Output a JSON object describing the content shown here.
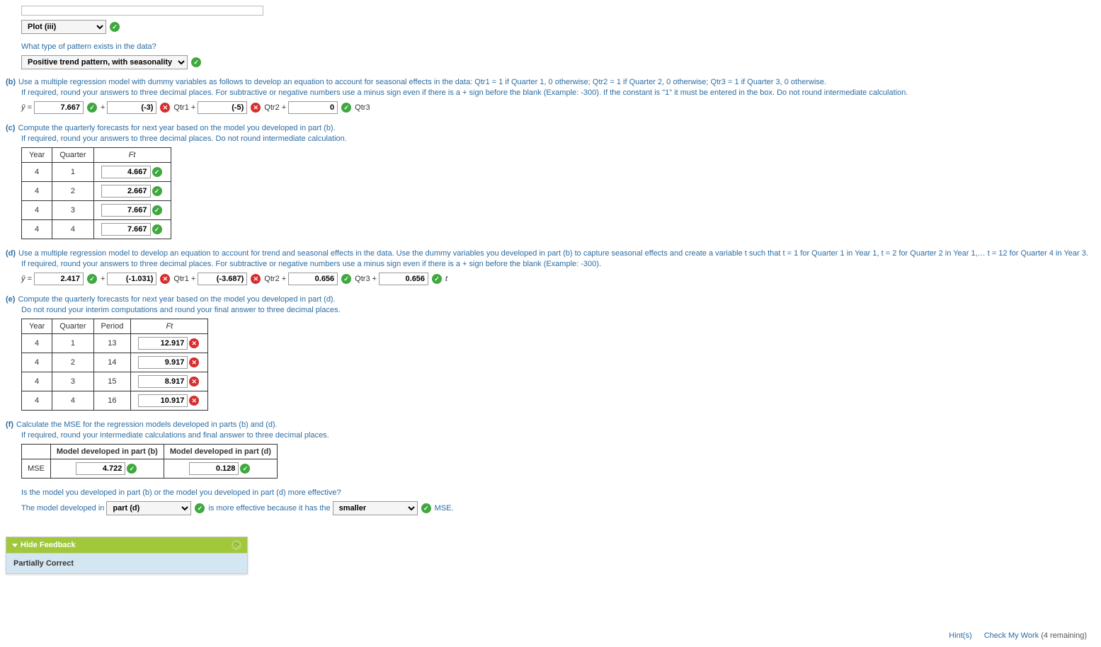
{
  "partA": {
    "plotPlaceholder": "",
    "plotSelection": "Plot (iii)",
    "question": "What type of pattern exists in the data?",
    "patternSelection": "Positive trend pattern, with seasonality"
  },
  "partB": {
    "label": "(b)",
    "prompt": "Use a multiple regression model with dummy variables as follows to develop an equation to account for seasonal effects in the data: Qtr1 = 1 if Quarter 1, 0 otherwise; Qtr2 = 1 if Quarter 2, 0 otherwise; Qtr3 = 1 if Quarter 3, 0 otherwise.",
    "note": "If required, round your answers to three decimal places. For subtractive or negative numbers use a minus sign even if there is a + sign before the blank (Example: -300). If the constant is \"1\" it must be entered in the box. Do not round intermediate calculation.",
    "yhat": "ŷ =",
    "intercept": "7.667",
    "b1": "(-3)",
    "b2": "(-5)",
    "b3": "0",
    "q1": "Qtr1 +",
    "q2": "Qtr2 +",
    "q3": "Qtr3",
    "plus": "+"
  },
  "partC": {
    "label": "(c)",
    "prompt": "Compute the quarterly forecasts for next year based on the model you developed in part (b).",
    "note": "If required, round your answers to three decimal places. Do not round intermediate calculation.",
    "headers": {
      "year": "Year",
      "quarter": "Quarter",
      "ft": "Ft"
    },
    "rows": [
      {
        "year": "4",
        "quarter": "1",
        "value": "4.667",
        "correct": true
      },
      {
        "year": "4",
        "quarter": "2",
        "value": "2.667",
        "correct": true
      },
      {
        "year": "4",
        "quarter": "3",
        "value": "7.667",
        "correct": true
      },
      {
        "year": "4",
        "quarter": "4",
        "value": "7.667",
        "correct": true
      }
    ]
  },
  "partD": {
    "label": "(d)",
    "prompt": "Use a multiple regression model to develop an equation to account for trend and seasonal effects in the data. Use the dummy variables you developed in part (b) to capture seasonal effects and create a variable t such that t = 1 for Quarter 1 in Year 1, t = 2 for Quarter 2 in Year 1,… t = 12 for Quarter 4 in Year 3.",
    "note": "If required, round your answers to three decimal places. For subtractive or negative numbers use a minus sign even if there is a + sign before the blank (Example: -300).",
    "yhat": "ŷ =",
    "intercept": "2.417",
    "b1": "(-1.031)",
    "b2": "(-3.687)",
    "b3": "0.656",
    "b4": "0.656",
    "q1": "Qtr1 +",
    "q2": "Qtr2 +",
    "q3": "Qtr3 +",
    "t": "t",
    "plus": "+"
  },
  "partE": {
    "label": "(e)",
    "prompt": "Compute the quarterly forecasts for next year based on the model you developed in part (d).",
    "note": "Do not round your interim computations and round your final answer to three decimal places.",
    "headers": {
      "year": "Year",
      "quarter": "Quarter",
      "period": "Period",
      "ft": "Ft"
    },
    "rows": [
      {
        "year": "4",
        "quarter": "1",
        "period": "13",
        "value": "12.917",
        "correct": false
      },
      {
        "year": "4",
        "quarter": "2",
        "period": "14",
        "value": "9.917",
        "correct": false
      },
      {
        "year": "4",
        "quarter": "3",
        "period": "15",
        "value": "8.917",
        "correct": false
      },
      {
        "year": "4",
        "quarter": "4",
        "period": "16",
        "value": "10.917",
        "correct": false
      }
    ]
  },
  "partF": {
    "label": "(f)",
    "prompt": "Calculate the MSE for the regression models developed in parts (b) and (d).",
    "note": "If required, round your intermediate calculations and final answer to three decimal places.",
    "headers": {
      "b": "Model developed in part (b)",
      "d": "Model developed in part (d)"
    },
    "rowLabel": "MSE",
    "mseB": "4.722",
    "mseD": "0.128",
    "question": "Is the model you developed in part (b) or the model you developed in part (d) more effective?",
    "conclusionPre": "The model developed in",
    "modelSelection": "part (d)",
    "conclusionMid": "is more effective because it has the",
    "sizeSelection": "smaller",
    "conclusionPost": "MSE."
  },
  "feedback": {
    "header": "Hide Feedback",
    "body": "Partially Correct"
  },
  "footer": {
    "hints": "Hint(s)",
    "check": "Check My Work",
    "remaining": "(4 remaining)"
  }
}
